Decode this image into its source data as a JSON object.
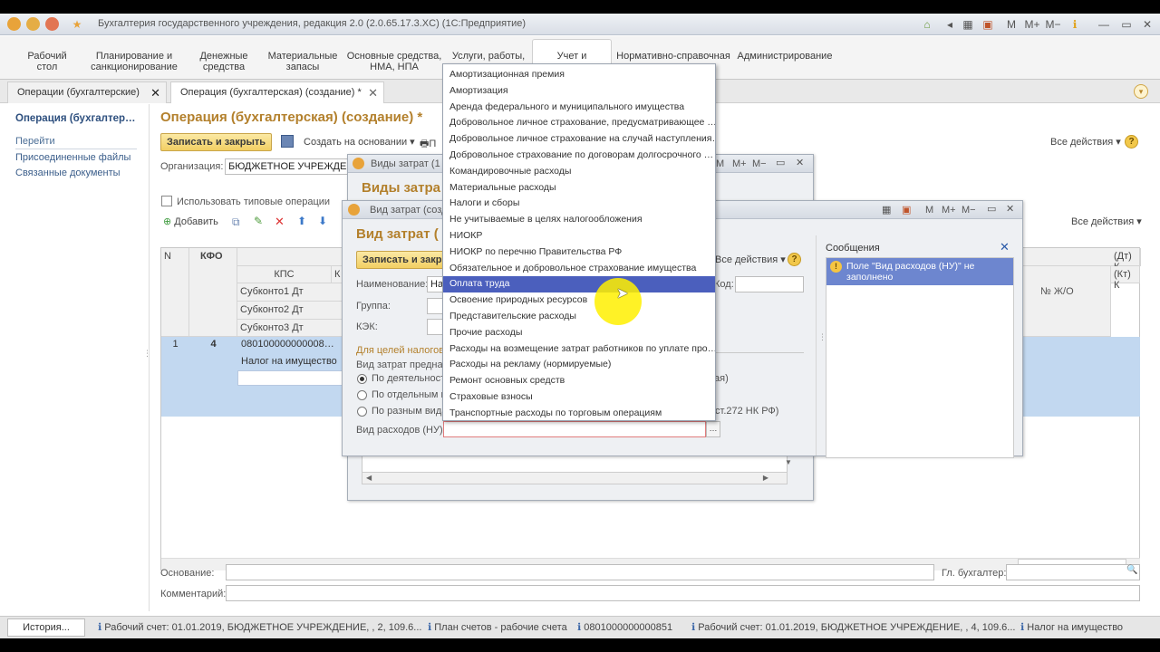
{
  "titlebar": {
    "title": "Бухгалтерия государственного учреждения, редакция 2.0 (2.0.65.17.3.XC) (1С:Предприятие)",
    "right_icons": [
      "M",
      "M+",
      "M−"
    ]
  },
  "sections": [
    {
      "l1": "Рабочий",
      "l2": "стол"
    },
    {
      "l1": "Планирование и",
      "l2": "санкционирование"
    },
    {
      "l1": "Денежные",
      "l2": "средства"
    },
    {
      "l1": "Материальные",
      "l2": "запасы"
    },
    {
      "l1": "Основные средства,",
      "l2": "НМА, НПА"
    },
    {
      "l1": "Услуги, работы,",
      "l2": ""
    },
    {
      "l1": "Учет и",
      "l2": ""
    },
    {
      "l1": "Нормативно-справочная",
      "l2": ""
    },
    {
      "l1": "Администрирование",
      "l2": ""
    }
  ],
  "tabs": [
    {
      "label": "Операции (бухгалтерские)"
    },
    {
      "label": "Операция (бухгалтерская) (создание) *"
    }
  ],
  "left": {
    "title": "Операция (бухгалтер…",
    "go": "Перейти",
    "links": [
      "Присоединенные файлы",
      "Связанные документы"
    ]
  },
  "form": {
    "title": "Операция (бухгалтерская) (создание) *",
    "save_close": "Записать и закрыть",
    "create_based": "Создать на основании",
    "print_short": "П",
    "all_actions": "Все действия",
    "org_label": "Организация:",
    "org_value": "БЮДЖЕТНОЕ УЧРЕЖДЕН",
    "typical_ops": "Использовать типовые операции",
    "add": "Добавить",
    "all_actions2": "Все действия"
  },
  "grid": {
    "h_n": "N",
    "h_kfo": "КФО",
    "h_kps": "КПС",
    "h_k": "К",
    "sub1": "Субконто1 Дт",
    "sub2": "Субконто2 Дт",
    "sub3": "Субконто3 Дт",
    "right_h1": "(Дт) К",
    "right_h2": "(Кт) К",
    "right_h3": "№ Ж/О",
    "row_n": "1",
    "row_kfo": "4",
    "row_kps": "080100000000008…",
    "row_sub1": "Налог на имущество"
  },
  "bottom": {
    "basis_label": "Основание:",
    "chief_label": "Гл. бухгалтер:",
    "comment_label": "Комментарий:"
  },
  "win_back": {
    "title": "Виды затрат (1",
    "heading": "Виды затра",
    "icons": [
      "M",
      "M+",
      "M−"
    ]
  },
  "win_front": {
    "title": "Вид затрат (созд",
    "heading": "Вид затрат (",
    "save_short": "Записать и закр",
    "all_actions": "Все действия",
    "name_label": "Наименование:",
    "name_value": "На",
    "code_label": "Код:",
    "group_label": "Группа:",
    "kek_label": "КЭК:",
    "tax_section": "Для целей налогов",
    "purpose_label": "Вид затрат предназ",
    "radio1": "По деятельности",
    "radio1_tail": "ая)",
    "radio2": "По отдельным ви",
    "radio3": "По разным вида",
    "radio3_tail": "ст.272 НК РФ)",
    "nu_label": "Вид расходов (НУ):",
    "icons": [
      "M",
      "M+",
      "M−"
    ]
  },
  "messages": {
    "title": "Сообщения",
    "text": "Поле \"Вид расходов (НУ)\" не заполнено"
  },
  "dropdown": {
    "items": [
      "Амортизационная премия",
      "Амортизация",
      "Аренда федерального и муниципального имущества",
      "Добровольное личное страхование, предусматривающее …",
      "Добровольное личное страхование на случай наступления…",
      "Добровольное страхование по договорам долгосрочного …",
      "Командировочные расходы",
      "Материальные расходы",
      "Налоги и сборы",
      "Не учитываемые в целях налогообложения",
      "НИОКР",
      "НИОКР по перечню Правительства РФ",
      "Обязательное и добровольное страхование имущества",
      "Оплата труда",
      "Освоение природных ресурсов",
      "Представительские расходы",
      "Прочие расходы",
      "Расходы на возмещение затрат работников по уплате про…",
      "Расходы на рекламу (нормируемые)",
      "Ремонт основных средств",
      "Страховые взносы",
      "Транспортные расходы по торговым операциям"
    ],
    "highlighted": 13
  },
  "status": {
    "history": "История...",
    "items": [
      "Рабочий счет: 01.01.2019, БЮДЖЕТНОЕ УЧРЕЖДЕНИЕ, , 2, 109.6...",
      "План счетов - рабочие счета",
      "0801000000000851",
      "Рабочий счет: 01.01.2019, БЮДЖЕТНОЕ УЧРЕЖДЕНИЕ, , 4, 109.6...",
      "Налог на имущество"
    ]
  },
  "colors": {
    "accent_title": "#b3802c",
    "highlight": "#4b5fbd",
    "selection": "#c2d8f0",
    "message": "#6d86cf"
  }
}
